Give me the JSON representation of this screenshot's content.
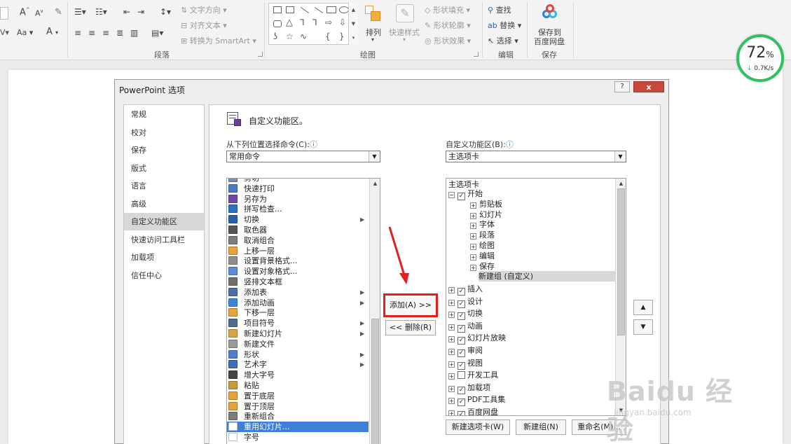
{
  "ribbon": {
    "font_grow": "A",
    "font_shrink": "A",
    "clear_format": "Aa",
    "font_color": "A",
    "text_direction": "文字方向",
    "align_text": "对齐文本",
    "convert_smartart": "转换为 SmartArt",
    "paragraph_group": "段落",
    "drawing_group": "绘图",
    "arrange": "排列",
    "quick_styles": "快速样式",
    "shape_fill": "形状填充",
    "shape_outline": "形状轮廓",
    "shape_effects": "形状效果",
    "find": "查找",
    "replace": "替换",
    "select": "选择",
    "editing_group": "编辑",
    "save_to_baidu_line1": "保存到",
    "save_to_baidu_line2": "百度网盘",
    "save_group": "保存"
  },
  "speed_widget": {
    "percent": "72",
    "percent_sign": "%",
    "rate": "0.7K/s"
  },
  "dialog": {
    "title": "PowerPoint 选项",
    "help": "?",
    "close": "x",
    "nav": [
      {
        "label": "常规",
        "selected": false
      },
      {
        "label": "校对",
        "selected": false
      },
      {
        "label": "保存",
        "selected": false
      },
      {
        "label": "版式",
        "selected": false
      },
      {
        "label": "语言",
        "selected": false
      },
      {
        "label": "高级",
        "selected": false
      },
      {
        "label": "自定义功能区",
        "selected": true
      },
      {
        "label": "快速访问工具栏",
        "selected": false
      },
      {
        "label": "加载项",
        "selected": false
      },
      {
        "label": "信任中心",
        "selected": false
      }
    ],
    "section_title": "自定义功能区。",
    "choose_label": "从下列位置选择命令(C):",
    "choose_value": "常用命令",
    "customize_label": "自定义功能区(B):",
    "customize_value": "主选项卡",
    "info_icon": "ⓘ",
    "commands": [
      {
        "label": "剪切",
        "icon": "cut-icon",
        "color": "#7a8fb0",
        "submenu": false,
        "selected": false
      },
      {
        "label": "快速打印",
        "icon": "quick-print-icon",
        "color": "#4a7cc4",
        "submenu": false,
        "selected": false
      },
      {
        "label": "另存为",
        "icon": "save-as-icon",
        "color": "#6b4aa8",
        "submenu": false,
        "selected": false
      },
      {
        "label": "拼写检查...",
        "icon": "spell-check-icon",
        "color": "#2f6fbf",
        "submenu": false,
        "selected": false
      },
      {
        "label": "切换",
        "icon": "transition-icon",
        "color": "#2d5fa8",
        "submenu": true,
        "selected": false
      },
      {
        "label": "取色器",
        "icon": "eyedropper-icon",
        "color": "#555555",
        "submenu": false,
        "selected": false
      },
      {
        "label": "取消组合",
        "icon": "ungroup-icon",
        "color": "#7d7d7d",
        "submenu": false,
        "selected": false
      },
      {
        "label": "上移一层",
        "icon": "bring-forward-icon",
        "color": "#e6a23c",
        "submenu": false,
        "selected": false
      },
      {
        "label": "设置背景格式...",
        "icon": "background-format-icon",
        "color": "#8e8e8e",
        "submenu": false,
        "selected": false
      },
      {
        "label": "设置对象格式...",
        "icon": "object-format-icon",
        "color": "#5a8ed8",
        "submenu": false,
        "selected": false
      },
      {
        "label": "竖排文本框",
        "icon": "vertical-textbox-icon",
        "color": "#6f6f6f",
        "submenu": false,
        "selected": false
      },
      {
        "label": "添加表",
        "icon": "table-icon",
        "color": "#4a6fa8",
        "submenu": true,
        "selected": false
      },
      {
        "label": "添加动画",
        "icon": "animation-icon",
        "color": "#3f86d8",
        "submenu": true,
        "selected": false
      },
      {
        "label": "下移一层",
        "icon": "send-backward-icon",
        "color": "#e6a23c",
        "submenu": false,
        "selected": false
      },
      {
        "label": "项目符号",
        "icon": "bullets-icon",
        "color": "#556a8a",
        "submenu": true,
        "selected": false
      },
      {
        "label": "新建幻灯片",
        "icon": "new-slide-icon",
        "color": "#d9a441",
        "submenu": true,
        "selected": false
      },
      {
        "label": "新建文件",
        "icon": "new-file-icon",
        "color": "#9a9a9a",
        "submenu": false,
        "selected": false
      },
      {
        "label": "形状",
        "icon": "shapes-icon",
        "color": "#4f7fc7",
        "submenu": true,
        "selected": false
      },
      {
        "label": "艺术字",
        "icon": "wordart-icon",
        "color": "#3e6fb8",
        "submenu": true,
        "selected": false
      },
      {
        "label": "增大字号",
        "icon": "grow-font-icon",
        "color": "#444444",
        "submenu": false,
        "selected": false
      },
      {
        "label": "粘贴",
        "icon": "paste-icon",
        "color": "#c79a3f",
        "submenu": false,
        "selected": false
      },
      {
        "label": "置于底层",
        "icon": "send-to-back-icon",
        "color": "#e6a23c",
        "submenu": false,
        "selected": false
      },
      {
        "label": "置于顶层",
        "icon": "bring-to-front-icon",
        "color": "#e6a23c",
        "submenu": false,
        "selected": false
      },
      {
        "label": "重新组合",
        "icon": "regroup-icon",
        "color": "#7d7d7d",
        "submenu": false,
        "selected": false
      },
      {
        "label": "重用幻灯片...",
        "icon": "reuse-slides-icon",
        "color": "#ffffff",
        "submenu": false,
        "selected": true
      },
      {
        "label": "字号",
        "icon": "font-size-icon",
        "color": "#ffffff",
        "submenu": false,
        "selected": false
      }
    ],
    "tree_header": "主选项卡",
    "tree": [
      {
        "label": "开始",
        "level": 0,
        "expanded": true,
        "checked": true,
        "highlight": false
      },
      {
        "label": "剪贴板",
        "level": 1,
        "expanded": false,
        "checked": null,
        "highlight": false
      },
      {
        "label": "幻灯片",
        "level": 1,
        "expanded": false,
        "checked": null,
        "highlight": false
      },
      {
        "label": "字体",
        "level": 1,
        "expanded": false,
        "checked": null,
        "highlight": false
      },
      {
        "label": "段落",
        "level": 1,
        "expanded": false,
        "checked": null,
        "highlight": false
      },
      {
        "label": "绘图",
        "level": 1,
        "expanded": false,
        "checked": null,
        "highlight": false
      },
      {
        "label": "编辑",
        "level": 1,
        "expanded": false,
        "checked": null,
        "highlight": false
      },
      {
        "label": "保存",
        "level": 1,
        "expanded": false,
        "checked": null,
        "highlight": false
      },
      {
        "label": "新建组 (自定义)",
        "level": 2,
        "expanded": false,
        "checked": null,
        "highlight": true
      },
      {
        "label": "插入",
        "level": 0,
        "expanded": false,
        "checked": true,
        "highlight": false
      },
      {
        "label": "设计",
        "level": 0,
        "expanded": false,
        "checked": true,
        "highlight": false
      },
      {
        "label": "切换",
        "level": 0,
        "expanded": false,
        "checked": true,
        "highlight": false
      },
      {
        "label": "动画",
        "level": 0,
        "expanded": false,
        "checked": true,
        "highlight": false
      },
      {
        "label": "幻灯片放映",
        "level": 0,
        "expanded": false,
        "checked": true,
        "highlight": false
      },
      {
        "label": "审阅",
        "level": 0,
        "expanded": false,
        "checked": true,
        "highlight": false
      },
      {
        "label": "视图",
        "level": 0,
        "expanded": false,
        "checked": true,
        "highlight": false
      },
      {
        "label": "开发工具",
        "level": 0,
        "expanded": false,
        "checked": false,
        "highlight": false
      },
      {
        "label": "加载项",
        "level": 0,
        "expanded": false,
        "checked": true,
        "highlight": false
      },
      {
        "label": "PDF工具集",
        "level": 0,
        "expanded": false,
        "checked": true,
        "highlight": false
      },
      {
        "label": "百度网盘",
        "level": 0,
        "expanded": false,
        "checked": true,
        "highlight": false
      }
    ],
    "add_button": "添加(A) >>",
    "remove_button": "<< 删除(R)",
    "new_tab_button": "新建选项卡(W)",
    "new_group_button": "新建组(N)",
    "rename_button": "重命名(M)..."
  },
  "watermark": {
    "big": "Baidu 经验",
    "small": "jingyan.baidu.com"
  },
  "colors": {
    "accent_red": "#e02020",
    "selection_blue": "#3f7fd9",
    "speed_green": "#2fc060"
  }
}
